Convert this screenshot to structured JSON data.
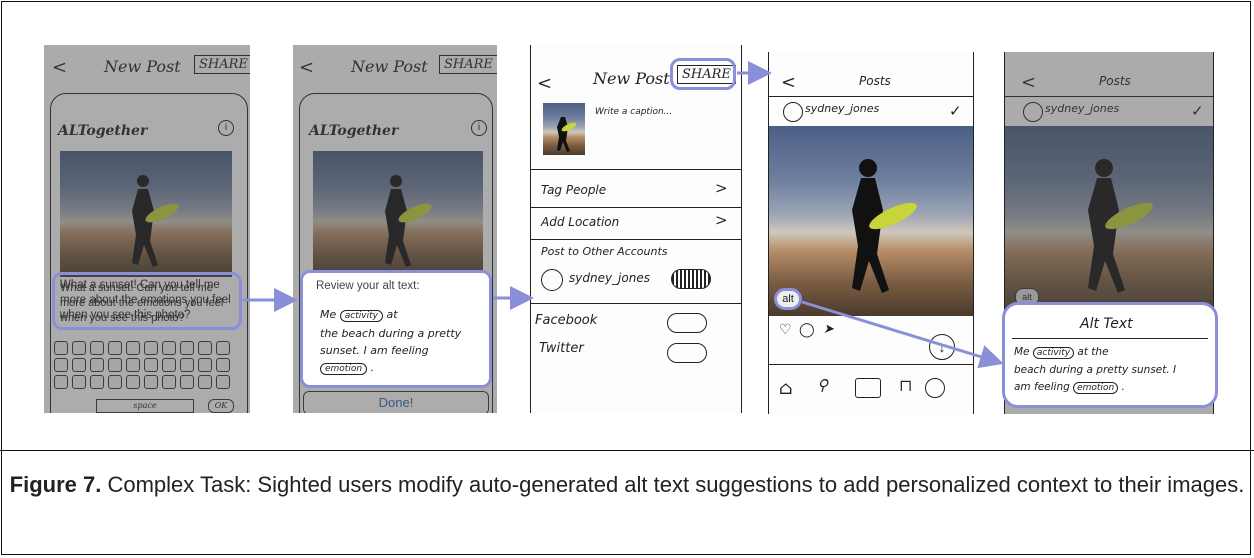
{
  "figure": {
    "caption_label": "Figure 7.",
    "caption_text": " Complex Task: Sighted users modify auto-generated alt text suggestions to add personalized context to their images."
  },
  "panel1": {
    "header_title": "New Post",
    "share_label": "SHARE",
    "app_name": "ALTogether",
    "prompt": "What a sunset! Can you tell me more about the emotions you feel when you see this photo?",
    "space_label": "space",
    "ok_label": "OK"
  },
  "panel2": {
    "header_title": "New Post",
    "share_label": "SHARE",
    "app_name": "ALTogether",
    "review_label": "Review your alt text:",
    "alt_me": "Me",
    "alt_activity": "activity",
    "alt_at": "at",
    "alt_line2": "the beach during a pretty",
    "alt_line3": "sunset. I am feeling",
    "alt_emotion": "emotion",
    "done_label": "Done!"
  },
  "panel3": {
    "header_title": "New Post",
    "share_label": "SHARE",
    "caption_placeholder": "Write a caption...",
    "tag_people": "Tag People",
    "add_location": "Add Location",
    "post_other": "Post to Other Accounts",
    "account_name": "sydney_jones",
    "facebook": "Facebook",
    "twitter": "Twitter",
    "chevron": ">"
  },
  "panel4": {
    "header_title": "Posts",
    "username": "sydney_jones",
    "checkmark": "✓",
    "alt_badge": "alt"
  },
  "panel5": {
    "header_title": "Posts",
    "username": "sydney_jones",
    "checkmark": "✓",
    "alt_badge": "alt",
    "alt_title": "Alt Text",
    "alt_me": "Me",
    "alt_activity": "activity",
    "alt_rest1": "at the",
    "alt_line2": "beach during a pretty sunset. I",
    "alt_line3": "am feeling",
    "alt_emotion": "emotion"
  },
  "colors": {
    "highlight": "#8a8fd8",
    "ink": "#222222"
  }
}
